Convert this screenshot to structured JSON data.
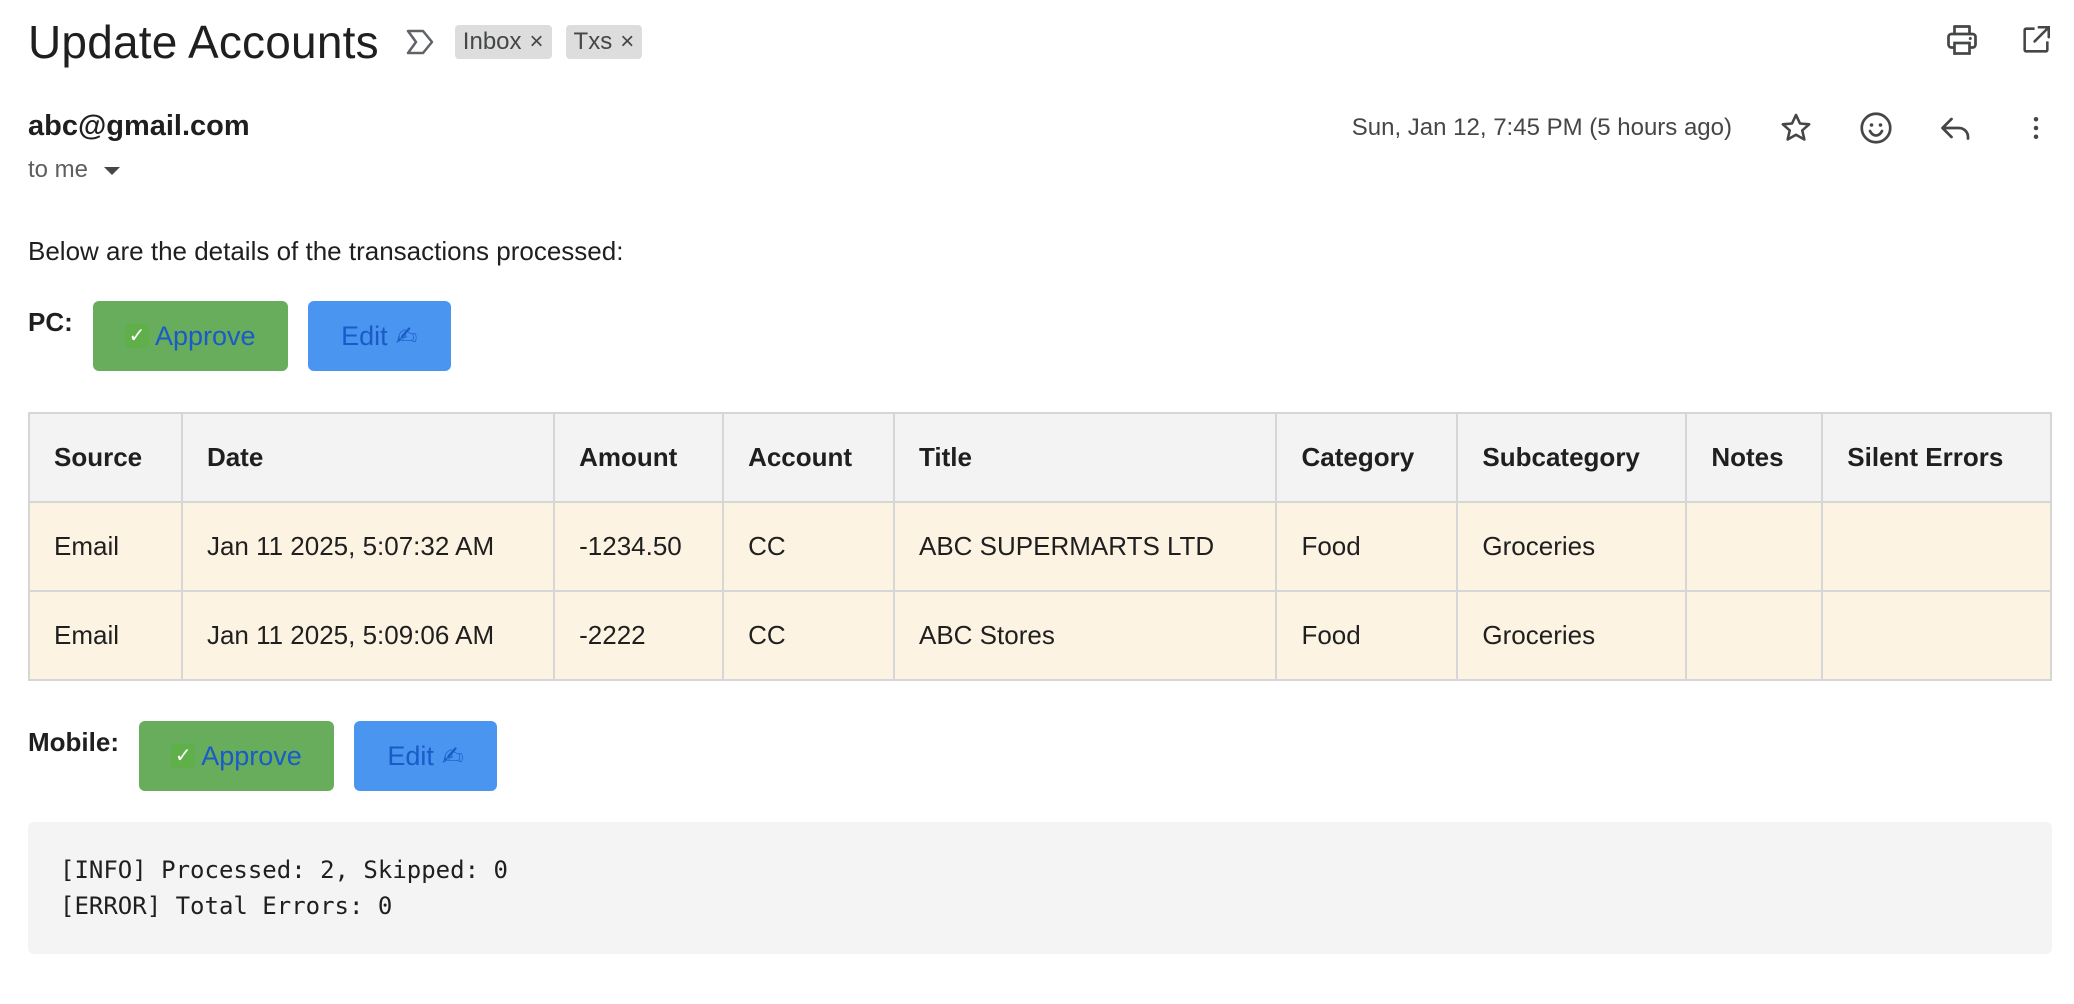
{
  "email": {
    "subject": "Update Accounts",
    "labels": [
      {
        "name": "Inbox"
      },
      {
        "name": "Txs"
      }
    ],
    "sender": "abc@gmail.com",
    "recipient": "to me",
    "date": "Sun, Jan 12, 7:45 PM (5 hours ago)"
  },
  "icons": {
    "important": "important-label-icon",
    "print": "print-icon",
    "open_new_window": "open-in-new-window-icon",
    "star": "star-icon",
    "emoji": "emoji-reaction-icon",
    "reply": "reply-icon",
    "more": "more-vertical-icon"
  },
  "body": {
    "intro": "Below are the details of the transactions processed:",
    "pc": {
      "label": "PC:",
      "approve": "Approve",
      "edit": "Edit"
    },
    "mobile": {
      "label": "Mobile:",
      "approve": "Approve",
      "edit": "Edit"
    },
    "table": {
      "headers": [
        "Source",
        "Date",
        "Amount",
        "Account",
        "Title",
        "Category",
        "Subcategory",
        "Notes",
        "Silent Errors"
      ],
      "rows": [
        [
          "Email",
          "Jan 11 2025, 5:07:32 AM",
          "-1234.50",
          "CC",
          "ABC SUPERMARTS LTD",
          "Food",
          "Groceries",
          "",
          ""
        ],
        [
          "Email",
          "Jan 11 2025, 5:09:06 AM",
          "-2222",
          "CC",
          "ABC Stores",
          "Food",
          "Groceries",
          "",
          ""
        ]
      ]
    },
    "log": {
      "line1": "[INFO] Processed: 2, Skipped: 0",
      "line2": "[ERROR] Total Errors: 0"
    }
  },
  "colors": {
    "approve_bg": "#67ad5b",
    "edit_bg": "#4a95ef",
    "button_text": "#1a5bc9",
    "table_header_bg": "#f3f3f3",
    "table_row_bg": "#fcf3e3",
    "log_bg": "#f4f4f4"
  }
}
